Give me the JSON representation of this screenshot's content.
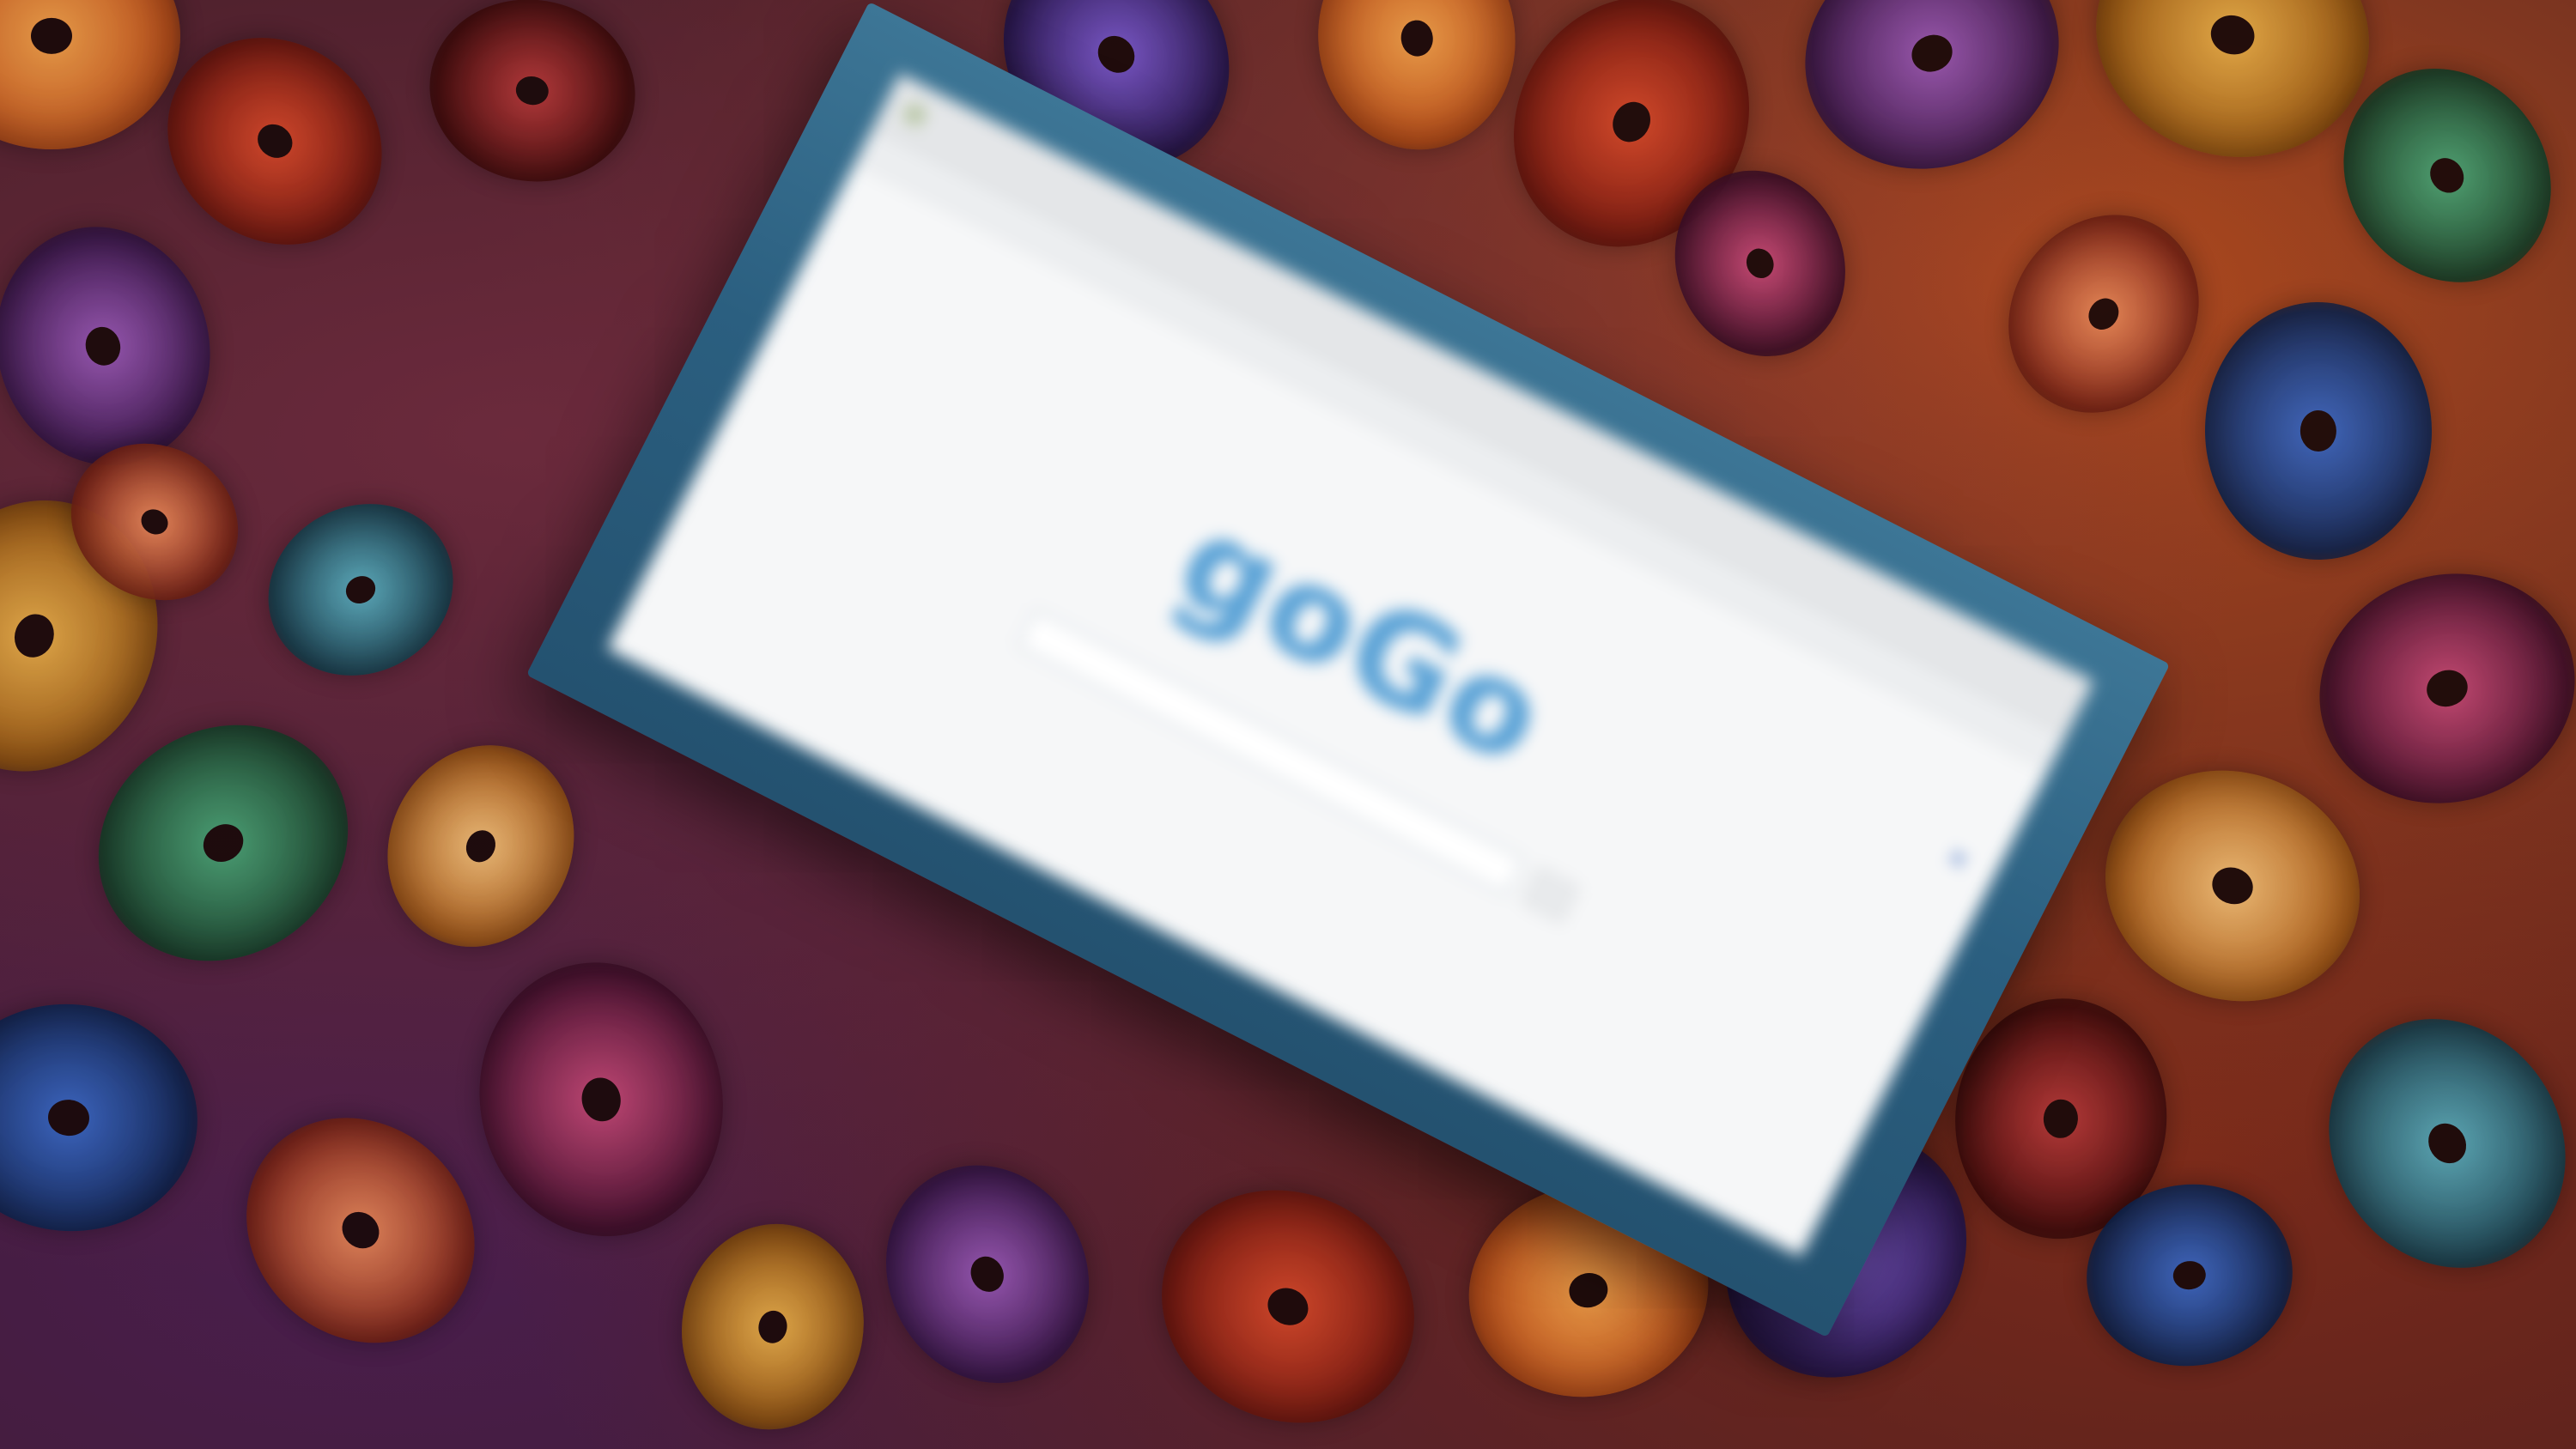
{
  "browser": {
    "toolbar_icon": "favicon-icon",
    "toolbar_text": "",
    "nav_links": [
      "",
      "",
      "",
      ""
    ]
  },
  "page": {
    "logo_text": "goGo",
    "tagline": "",
    "search": {
      "value": "",
      "placeholder": "",
      "button_label": ""
    },
    "options": [
      "",
      ""
    ],
    "side_links": [
      "",
      ""
    ]
  },
  "colors": {
    "frame": "#2b5f80",
    "logo": "#5aa2d6",
    "page_bg": "#f6f7f8"
  }
}
